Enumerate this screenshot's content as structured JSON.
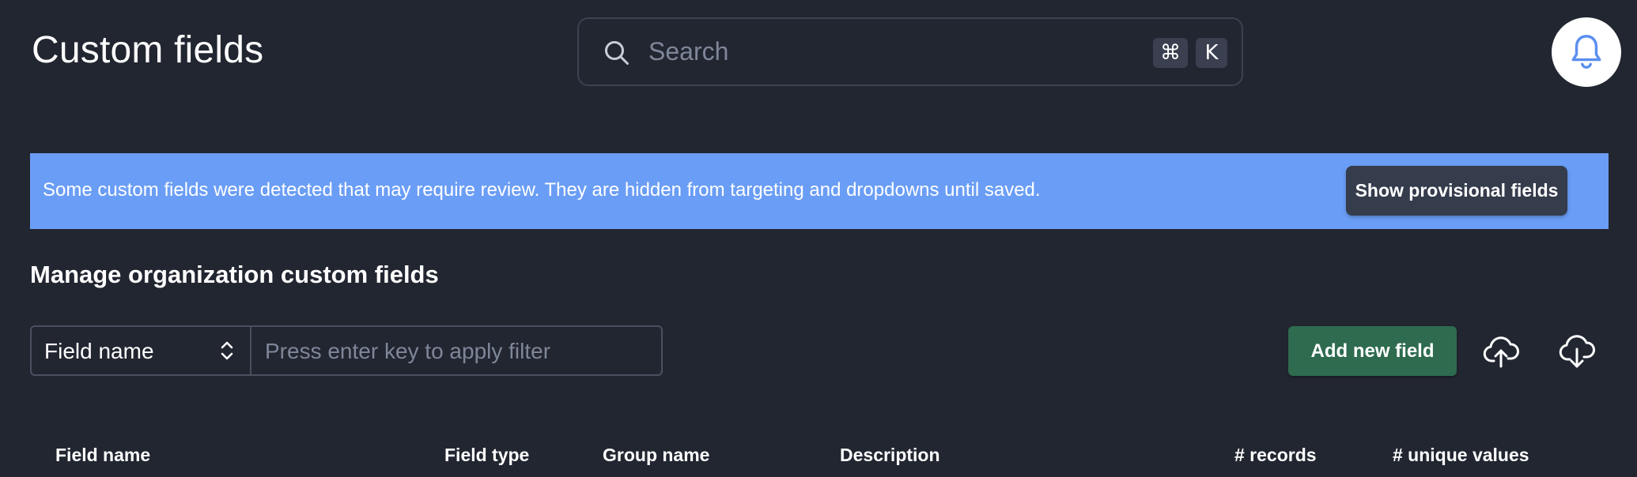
{
  "header": {
    "title": "Custom fields",
    "search": {
      "placeholder": "Search",
      "shortcut_cmd": "⌘",
      "shortcut_key": "K"
    },
    "notifications_icon": "bell-icon"
  },
  "banner": {
    "message": "Some custom fields were detected that may require review. They are hidden from targeting and dropdowns until saved.",
    "button_label": "Show provisional fields",
    "background": "#6a9df5"
  },
  "section": {
    "title": "Manage organization custom fields"
  },
  "filter": {
    "selected_field": "Field name",
    "input_placeholder": "Press enter key to apply filter"
  },
  "actions": {
    "add_label": "Add new field",
    "upload_icon": "cloud-upload-icon",
    "download_icon": "cloud-download-icon",
    "add_color": "#2e6b4f"
  },
  "table": {
    "columns": [
      "Field name",
      "Field type",
      "Group name",
      "Description",
      "# records",
      "# unique values"
    ]
  }
}
